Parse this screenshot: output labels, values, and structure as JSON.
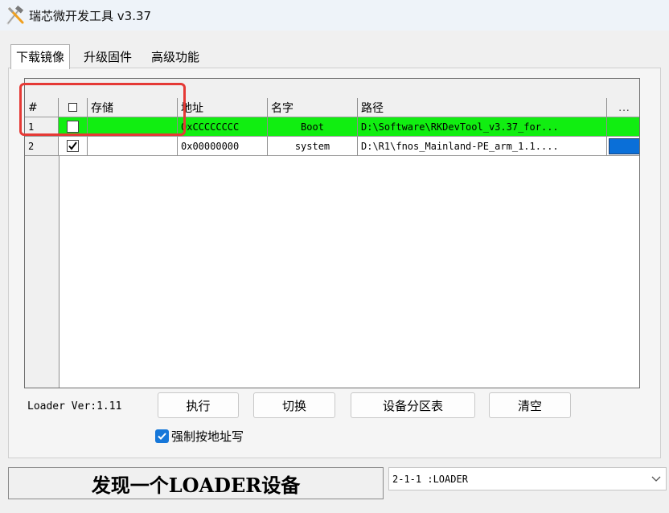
{
  "window": {
    "title": "瑞芯微开发工具 v3.37",
    "icon": "tools-icon"
  },
  "tabs": [
    {
      "label": "下载镜像",
      "active": true
    },
    {
      "label": "升级固件",
      "active": false
    },
    {
      "label": "高级功能",
      "active": false
    }
  ],
  "table": {
    "columns": [
      "#",
      "",
      "存储",
      "地址",
      "名字",
      "路径",
      "..."
    ],
    "rows": [
      {
        "num": "1",
        "checked": false,
        "storage": "",
        "address": "0xCCCCCCCC",
        "name": "Boot",
        "path": "D:\\Software\\RKDevTool_v3.37_for...",
        "more": "",
        "row_color": "#11ee11"
      },
      {
        "num": "2",
        "checked": true,
        "storage": "",
        "address": "0x00000000",
        "name": "system",
        "path": "D:\\R1\\fnos_Mainland-PE_arm_1.1....",
        "more": "",
        "more_color": "#0a6fd8"
      }
    ]
  },
  "loader_version": "Loader Ver:1.11",
  "buttons": {
    "run": "执行",
    "switch": "切换",
    "partition_table": "设备分区表",
    "clear": "清空"
  },
  "force_write": {
    "label": "强制按地址写",
    "checked": true
  },
  "status": {
    "text": "发现一个LOADER设备"
  },
  "device_select": {
    "value": "2-1-1 :LOADER"
  },
  "colors": {
    "highlight_box": "#e53935",
    "checkbox_blue": "#1677d9"
  }
}
